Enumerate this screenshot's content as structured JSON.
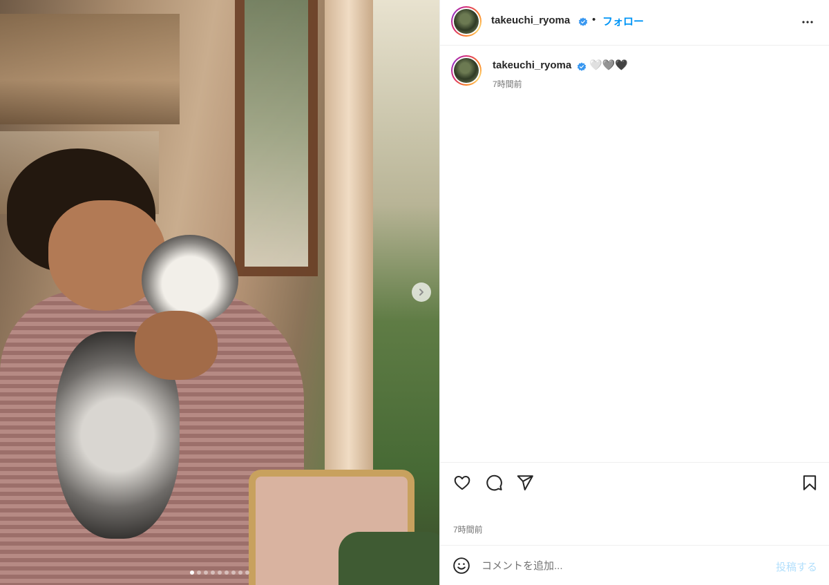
{
  "media": {
    "carousel_slide_count": 9,
    "active_slide": 1
  },
  "header": {
    "username": "takeuchi_ryoma",
    "separator": "•",
    "follow_label": "フォロー"
  },
  "caption": {
    "username": "takeuchi_ryoma",
    "text": "🤍🩶🖤",
    "time": "7時間前"
  },
  "actions": {
    "post_time": "7時間前"
  },
  "comment": {
    "placeholder": "コメントを追加...",
    "post_label": "投稿する"
  },
  "colors": {
    "verified": "#3897f0",
    "follow": "#0095f6",
    "post_disabled": "#b2dffc"
  }
}
